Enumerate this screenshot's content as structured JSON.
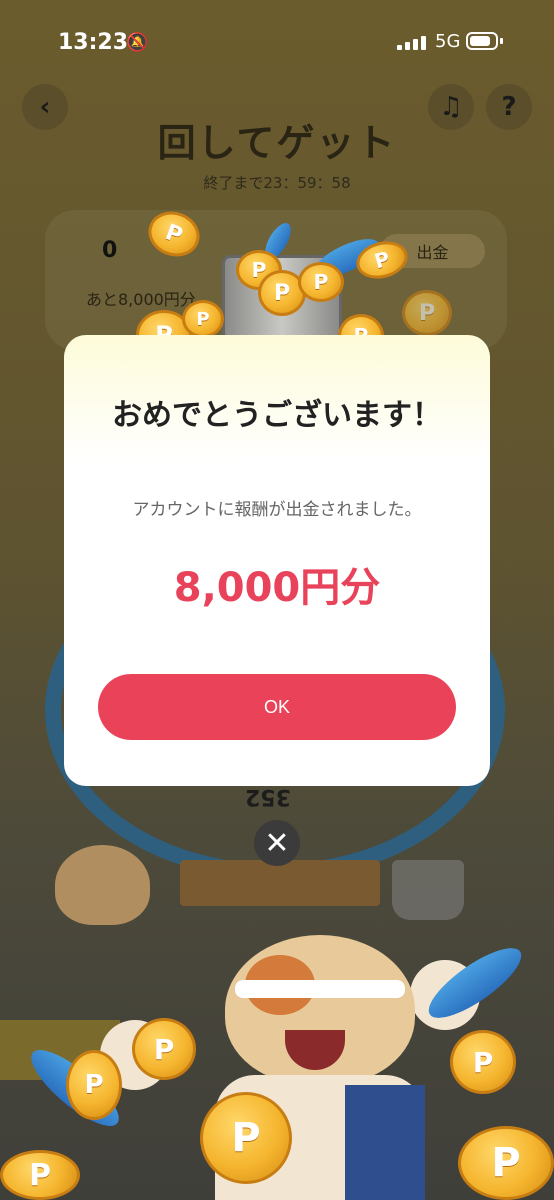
{
  "status_bar": {
    "time": "13:23",
    "network": "5G"
  },
  "game": {
    "title": "回してゲット",
    "timer": "終了まで23：59：58",
    "balance": "0",
    "withdraw_label": "出金",
    "remaining_text": "あと8,000円分",
    "wheel_segment_value": "352"
  },
  "dialog": {
    "title": "おめでとうございます！",
    "message": "アカウントに報酬が出金されました。",
    "amount": "8,000円分",
    "ok_label": "OK"
  },
  "coin_symbol": "P",
  "colors": {
    "accent": "#ea4359",
    "amount": "#e8435a",
    "coin": "#f5b52e"
  }
}
